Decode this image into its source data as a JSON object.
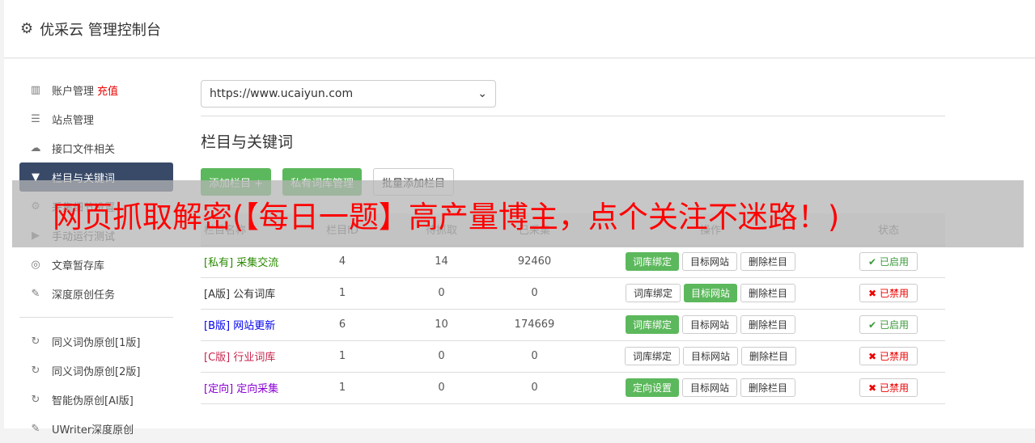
{
  "header": {
    "title": "优采云 管理控制台",
    "icon": "gear-icon"
  },
  "sidebar": {
    "items": [
      {
        "label": "账户管理",
        "extra": "充值",
        "icon": "bar-chart-icon"
      },
      {
        "label": "站点管理",
        "icon": "server-icon"
      },
      {
        "label": "接口文件相关",
        "icon": "cloud-upload-icon"
      },
      {
        "label": "栏目与关键词",
        "icon": "filter-icon",
        "active": true
      },
      {
        "label": "采集细节设置",
        "icon": "gears-icon"
      },
      {
        "label": "手动运行测试",
        "icon": "play-icon"
      },
      {
        "label": "文章暂存库",
        "icon": "database-icon"
      },
      {
        "label": "深度原创任务",
        "icon": "edit-icon"
      },
      {
        "label": "同义词伪原创[1版]",
        "icon": "refresh-icon"
      },
      {
        "label": "同义词伪原创[2版]",
        "icon": "refresh-icon"
      },
      {
        "label": "智能伪原创[AI版]",
        "icon": "refresh-icon"
      },
      {
        "label": "UWriter深度原创",
        "icon": "edit-icon"
      }
    ]
  },
  "site_select": {
    "value": "https://www.ucaiyun.com"
  },
  "section_title": "栏目与关键词",
  "buttons": {
    "add": "添加栏目 +",
    "private": "私有词库管理",
    "batch": "批量添加栏目"
  },
  "table": {
    "headers": [
      "栏目名称",
      "栏目ID",
      "待抓取",
      "已采集",
      "操作",
      "状态"
    ],
    "rows": [
      {
        "tag": "[私有]",
        "name": "采集交流",
        "color": "#2a8a00",
        "id": "4",
        "pending": "14",
        "collected": "92460",
        "op1": "词库绑定",
        "op1_active": true,
        "op2": "目标网站",
        "op2_active": false,
        "op3": "删除栏目",
        "status": "已启用",
        "enabled": true
      },
      {
        "tag": "[A版]",
        "name": "公有词库",
        "color": "#333333",
        "id": "1",
        "pending": "0",
        "collected": "0",
        "op1": "词库绑定",
        "op1_active": false,
        "op2": "目标网站",
        "op2_active": true,
        "op3": "删除栏目",
        "status": "已禁用",
        "enabled": false
      },
      {
        "tag": "[B版]",
        "name": "网站更新",
        "color": "#0000ee",
        "id": "6",
        "pending": "10",
        "collected": "174669",
        "op1": "词库绑定",
        "op1_active": true,
        "op2": "目标网站",
        "op2_active": false,
        "op3": "删除栏目",
        "status": "已启用",
        "enabled": true
      },
      {
        "tag": "[C版]",
        "name": "行业词库",
        "color": "#c7254e",
        "id": "1",
        "pending": "0",
        "collected": "0",
        "op1": "词库绑定",
        "op1_active": false,
        "op2": "目标网站",
        "op2_active": false,
        "op3": "删除栏目",
        "status": "已禁用",
        "enabled": false
      },
      {
        "tag": "[定向]",
        "name": "定向采集",
        "color": "#8a00d4",
        "id": "1",
        "pending": "0",
        "collected": "0",
        "op1": "定向设置",
        "op1_active": true,
        "op2": "目标网站",
        "op2_active": false,
        "op3": "删除栏目",
        "status": "已禁用",
        "enabled": false
      }
    ]
  },
  "overlay_banner": "网页抓取解密(【每日一题】高产量博主，点个关注不迷路！)"
}
